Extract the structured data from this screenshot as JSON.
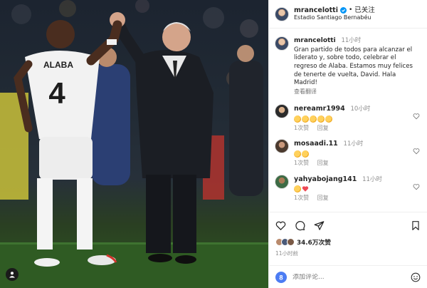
{
  "header": {
    "username": "mrancelotti",
    "follow_separator": "•",
    "follow_label": "已关注",
    "location": "Estadio Santiago Bernabéu"
  },
  "caption": {
    "username": "mrancelotti",
    "time": "11小时",
    "text": "Gran partido de todos para alcanzar el liderato y, sobre todo, celebrar el regreso de Alaba. Estamos muy felices de tenerte de vuelta, David. Hala Madrid!",
    "translate_label": "查看翻译"
  },
  "comments": [
    {
      "username": "nereamr1994",
      "time": "10小时",
      "emojis": [
        "clap-emoji",
        "clap-emoji",
        "clap-emoji",
        "clap-emoji",
        "clap-emoji"
      ],
      "likes": "1次赞",
      "reply_label": "回复"
    },
    {
      "username": "mosaadi.11",
      "time": "11小时",
      "emojis": [
        "clap-emoji",
        "clap-emoji"
      ],
      "likes": "1次赞",
      "reply_label": "回复"
    },
    {
      "username": "yahyabojang141",
      "time": "11小时",
      "emojis": [
        "clap-emoji",
        "red-heart-emoji"
      ],
      "likes": "1次赞",
      "reply_label": "回复"
    }
  ],
  "actions": {
    "likes_count": "34.6万次赞",
    "post_time": "11小时前"
  },
  "add_comment": {
    "placeholder": "添加评论..."
  },
  "photo": {
    "jersey_name": "ALABA",
    "jersey_number": "4"
  },
  "colors": {
    "verified_blue": "#0095f6",
    "heart_red": "#ed4956",
    "pitch_green": "#2f5b23"
  }
}
